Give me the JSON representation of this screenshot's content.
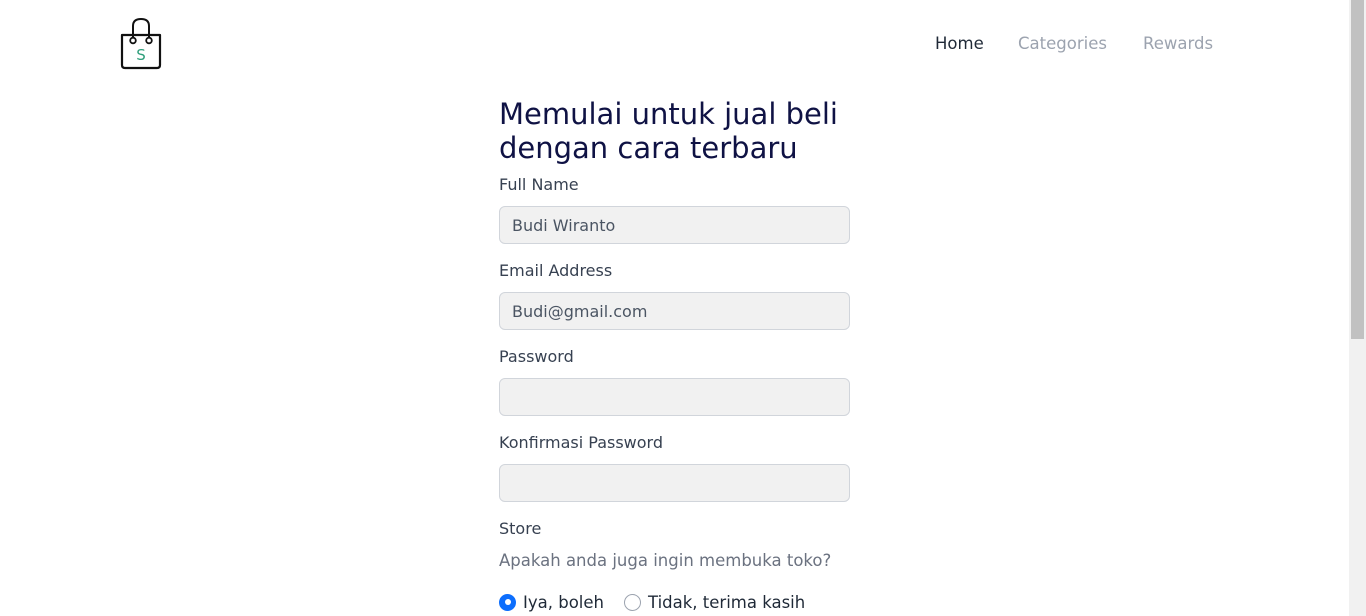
{
  "header": {
    "logo_letter": "S",
    "nav": [
      {
        "label": "Home",
        "active": true
      },
      {
        "label": "Categories",
        "active": false
      },
      {
        "label": "Rewards",
        "active": false
      }
    ]
  },
  "form": {
    "title_line1": "Memulai untuk jual beli",
    "title_line2": "dengan cara terbaru",
    "full_name": {
      "label": "Full Name",
      "value": "Budi Wiranto"
    },
    "email": {
      "label": "Email Address",
      "value": "Budi@gmail.com"
    },
    "password": {
      "label": "Password",
      "value": ""
    },
    "confirm_password": {
      "label": "Konfirmasi Password",
      "value": ""
    },
    "store": {
      "label": "Store",
      "question": "Apakah anda juga ingin membuka toko?",
      "options": [
        {
          "label": "Iya, boleh",
          "selected": true
        },
        {
          "label": "Tidak, terima kasih",
          "selected": false
        }
      ]
    }
  },
  "colors": {
    "brand_green": "#2e9e7a",
    "title_navy": "#0f1244",
    "radio_blue": "#0d6efd"
  }
}
